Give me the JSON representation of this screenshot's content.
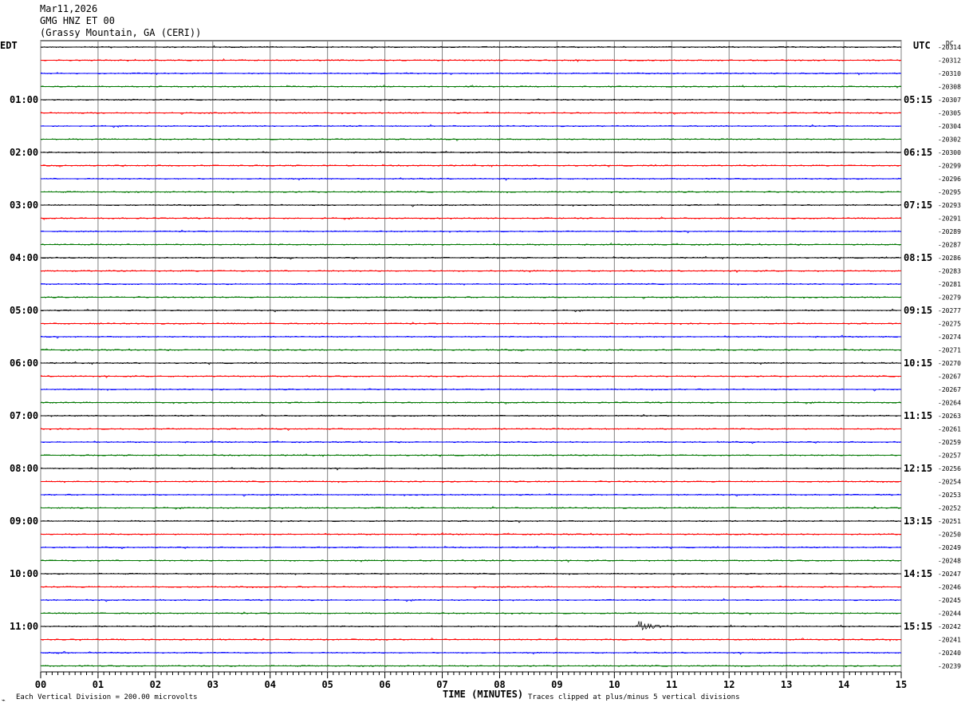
{
  "header": {
    "date": "Mar11,2026",
    "station": "GMG HNZ ET 00",
    "location": "(Grassy Mountain, GA (CERI))"
  },
  "chart_data": {
    "type": "line",
    "title": "",
    "left_axis_label": "EDT",
    "right_axis_label": "UTC",
    "dc_label": "DC",
    "xlabel": "TIME (MINUTES)",
    "x_ticks": [
      "00",
      "01",
      "02",
      "03",
      "04",
      "05",
      "06",
      "07",
      "08",
      "09",
      "10",
      "11",
      "12",
      "13",
      "14",
      "15"
    ],
    "xlim": [
      0,
      15
    ],
    "left_hour_labels": [
      "01:00",
      "02:00",
      "03:00",
      "04:00",
      "05:00",
      "06:00",
      "07:00",
      "08:00",
      "09:00",
      "10:00",
      "11:00"
    ],
    "right_hour_labels": [
      "05:15",
      "06:15",
      "07:15",
      "08:15",
      "09:15",
      "10:15",
      "11:15",
      "12:15",
      "13:15",
      "14:15",
      "15:15"
    ],
    "trace_colors": [
      "#000000",
      "#ff0000",
      "#0000ff",
      "#007700"
    ],
    "dc_offsets": [
      -20314,
      -20312,
      -20310,
      -20308,
      -20307,
      -20305,
      -20304,
      -20302,
      -20300,
      -20299,
      -20296,
      -20295,
      -20293,
      -20291,
      -20289,
      -20287,
      -20286,
      -20283,
      -20281,
      -20279,
      -20277,
      -20275,
      -20274,
      -20271,
      -20270,
      -20267,
      -20267,
      -20264,
      -20263,
      -20261,
      -20259,
      -20257,
      -20256,
      -20254,
      -20253,
      -20252,
      -20251,
      -20250,
      -20249,
      -20248,
      -20247,
      -20246,
      -20245,
      -20244,
      -20242,
      -20241,
      -20240,
      -20239
    ],
    "events": [
      {
        "trace": 44,
        "minute": 10.4,
        "amplitude": "large"
      },
      {
        "trace": 46,
        "minute": 0.35,
        "amplitude": "small"
      }
    ],
    "grid": true
  },
  "footer": {
    "scale_note": "Each Vertical Division =  200.00 microvolts",
    "clip_note": "Traces clipped at plus/minus 5 vertical divisions"
  }
}
